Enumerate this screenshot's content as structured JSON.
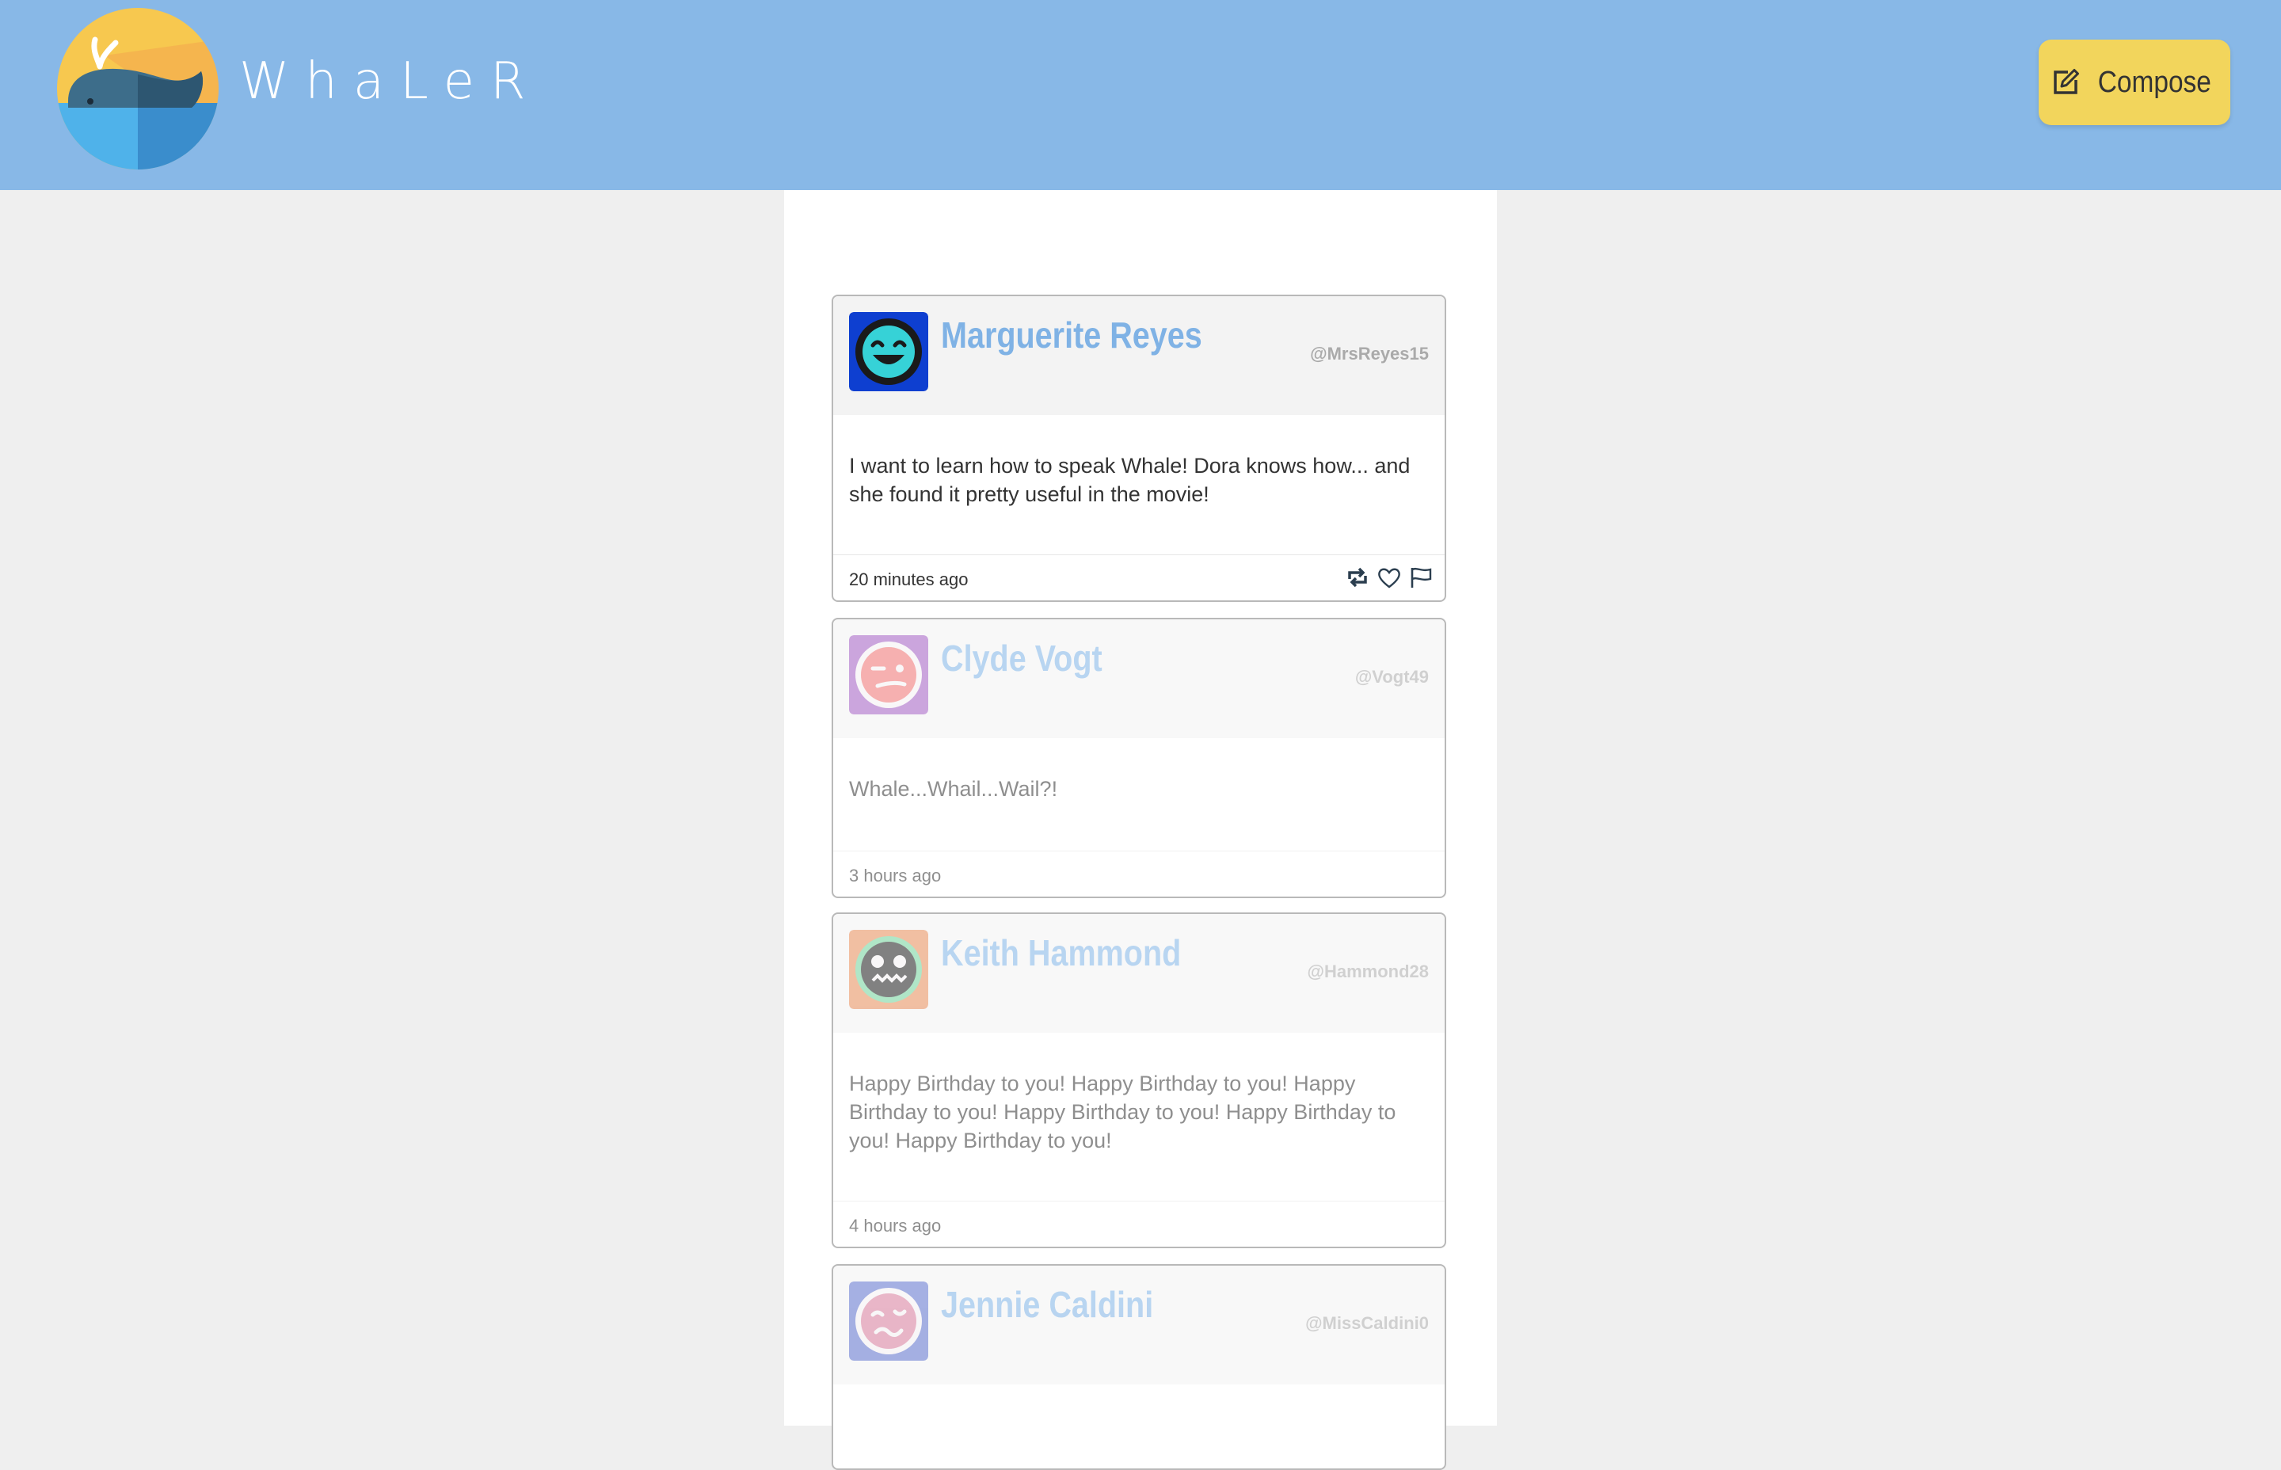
{
  "app": {
    "brand": "WhaLeR",
    "compose_label": "Compose"
  },
  "colors": {
    "header_bg": "#88b8e7",
    "compose_bg": "#f2d55c",
    "name_color": "#7fb2e5"
  },
  "feed": [
    {
      "name": "Marguerite Reyes",
      "handle": "@MrsReyes15",
      "text": "I want to learn how to speak Whale! Dora knows how... and she found it pretty useful in the movie!",
      "time": "20 minutes ago",
      "avatar_icon": "grinning-face-icon",
      "avatar_bg": "#0e3fd0",
      "actions": [
        "retweet-icon",
        "heart-icon",
        "flag-icon"
      ]
    },
    {
      "name": "Clyde Vogt",
      "handle": "@Vogt49",
      "text": "Whale...Whail...Wail?!",
      "time": "3 hours ago",
      "avatar_icon": "winking-face-icon",
      "avatar_bg": "#a15cc2"
    },
    {
      "name": "Keith Hammond",
      "handle": "@Hammond28",
      "text": "Happy Birthday to you! Happy Birthday to you! Happy Birthday to you!  Happy Birthday to you! Happy Birthday to you! Happy Birthday to you!",
      "time": "4 hours ago",
      "avatar_icon": "zany-face-icon",
      "avatar_bg": "#e58a57"
    },
    {
      "name": "Jennie Caldini",
      "handle": "@MissCaldini0",
      "text": "",
      "time": "",
      "avatar_icon": "woozy-face-icon",
      "avatar_bg": "#5b6fcc"
    }
  ]
}
